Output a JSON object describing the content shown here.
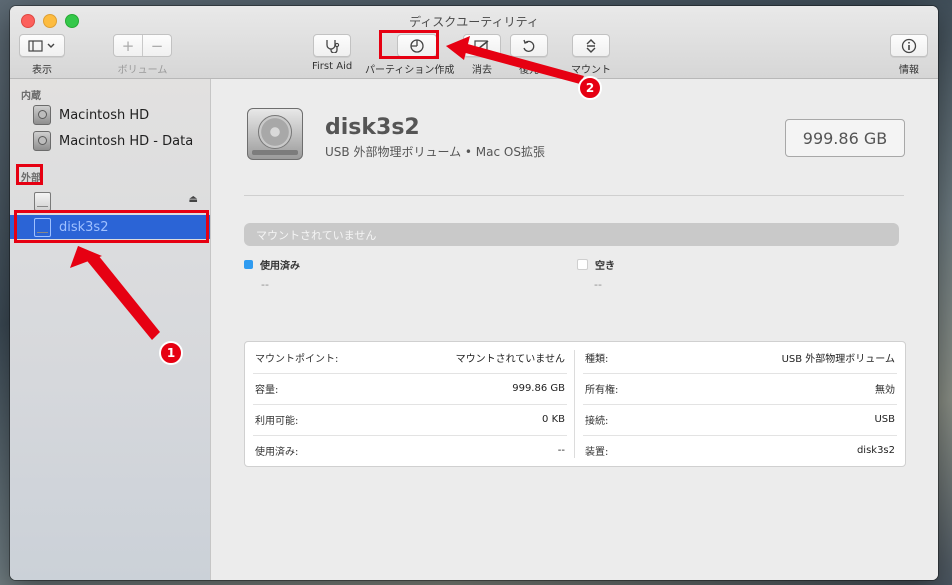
{
  "window": {
    "title": "ディスクユーティリティ"
  },
  "toolbar": {
    "view_label": "表示",
    "volume_label": "ボリューム",
    "firstaid_label": "First Aid",
    "partition_label": "パーティション作成",
    "erase_label": "消去",
    "restore_label": "復元",
    "mount_label": "マウント",
    "info_label": "情報"
  },
  "sidebar": {
    "internal_header": "内蔵",
    "internal_items": [
      "Macintosh HD",
      "Macintosh HD - Data"
    ],
    "external_header": "外部",
    "external_items": [
      "",
      "disk3s2"
    ],
    "selected": "disk3s2"
  },
  "volume": {
    "name": "disk3s2",
    "subtitle": "USB 外部物理ボリューム • Mac OS拡張",
    "capacity": "999.86 GB",
    "usage_text": "マウントされていません",
    "used_label": "使用済み",
    "used_value": "--",
    "used_color": "#2f9bf0",
    "free_label": "空き",
    "free_value": "--",
    "free_color": "#ffffff"
  },
  "info": {
    "left": [
      {
        "key": "マウントポイント:",
        "value": "マウントされていません"
      },
      {
        "key": "容量:",
        "value": "999.86 GB"
      },
      {
        "key": "利用可能:",
        "value": "0 KB"
      },
      {
        "key": "使用済み:",
        "value": "--"
      }
    ],
    "right": [
      {
        "key": "種類:",
        "value": "USB 外部物理ボリューム"
      },
      {
        "key": "所有権:",
        "value": "無効"
      },
      {
        "key": "接続:",
        "value": "USB"
      },
      {
        "key": "装置:",
        "value": "disk3s2"
      }
    ]
  },
  "annotations": {
    "step1": "1",
    "step2": "2",
    "color": "#e60012"
  }
}
